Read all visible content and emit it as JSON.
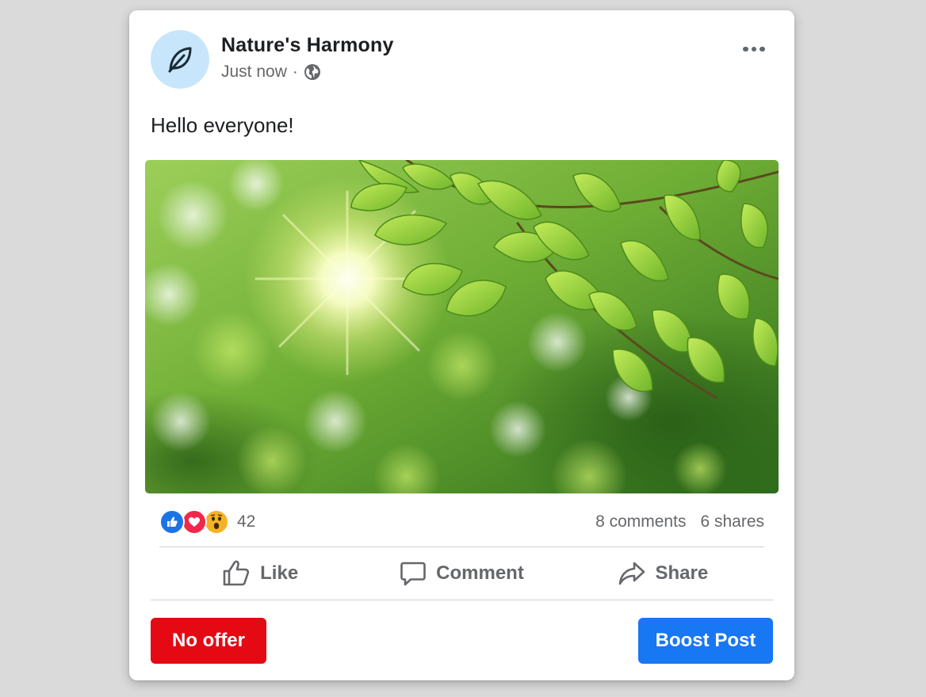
{
  "post": {
    "page_name": "Nature's Harmony",
    "timestamp": "Just now",
    "separator": "·",
    "privacy_icon": "globe-icon",
    "avatar_icon": "leaf-icon",
    "text": "Hello everyone!",
    "image_description_icon": "sunlit-leaves-photo"
  },
  "engagement": {
    "reaction_icons": [
      "like-reaction-icon",
      "love-reaction-icon",
      "wow-reaction-icon"
    ],
    "reaction_count": "42",
    "comments": "8 comments",
    "shares": "6 shares"
  },
  "actions": {
    "like_label": "Like",
    "comment_label": "Comment",
    "share_label": "Share"
  },
  "footer": {
    "no_offer_label": "No offer",
    "boost_label": "Boost Post"
  },
  "colors": {
    "brand_blue": "#1877f2",
    "no_offer_red": "#e50914",
    "avatar_bg": "#c7e6fb",
    "text_secondary": "#65676b"
  }
}
